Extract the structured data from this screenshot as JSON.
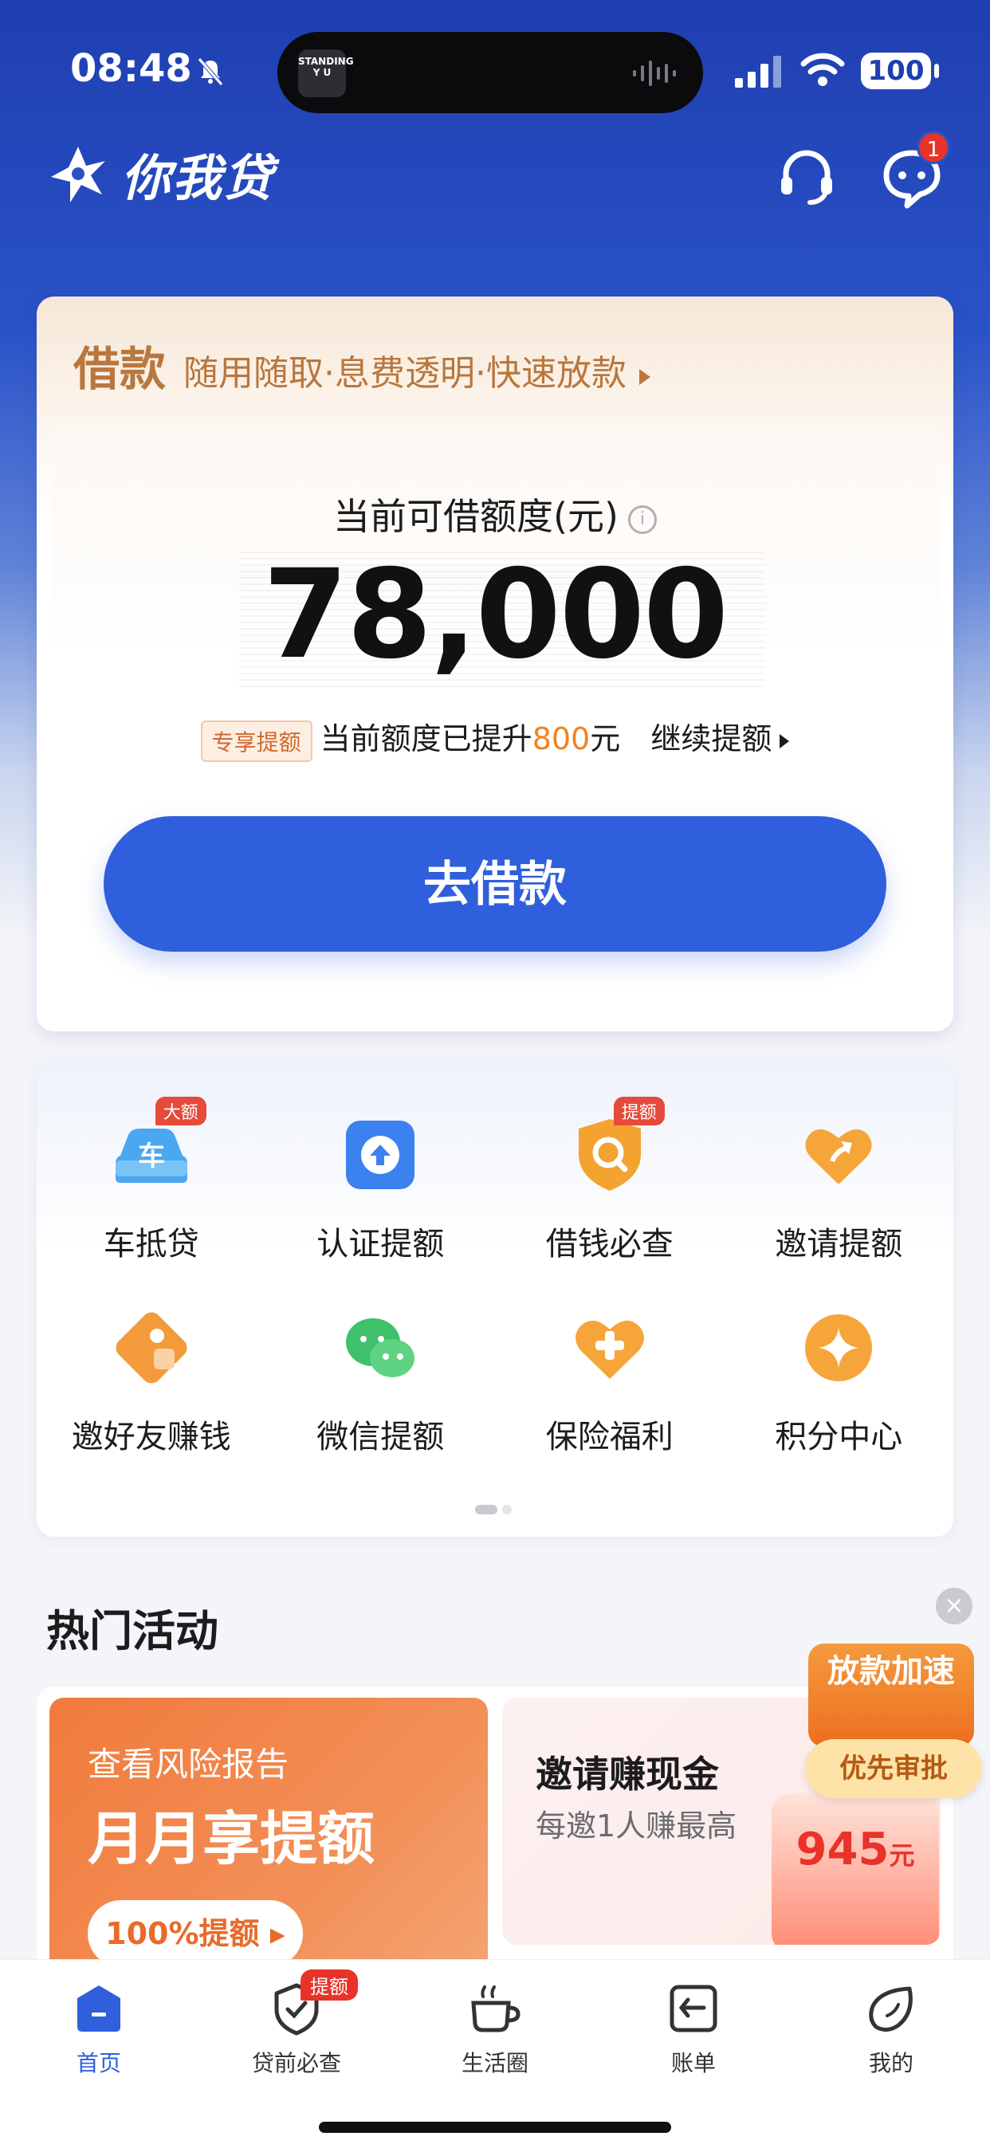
{
  "status": {
    "time": "08:48",
    "battery": "100",
    "island_art": "STANDING Y U"
  },
  "header": {
    "logo_text": "你我贷",
    "message_badge": "1"
  },
  "loan": {
    "head_title": "借款",
    "head_sub": "随用随取·息费透明·快速放款",
    "limit_label": "当前可借额度(元)",
    "amount": "78,000",
    "promo_tag": "专享提额",
    "promo_text": "当前额度已提升",
    "promo_num": "800",
    "promo_unit": "元",
    "promo_link": "继续提额",
    "button": "去借款"
  },
  "grid": {
    "items": [
      {
        "label": "车抵贷",
        "badge": "大额"
      },
      {
        "label": "认证提额",
        "badge": ""
      },
      {
        "label": "借钱必查",
        "badge": "提额"
      },
      {
        "label": "邀请提额",
        "badge": ""
      },
      {
        "label": "邀好友赚钱",
        "badge": ""
      },
      {
        "label": "微信提额",
        "badge": ""
      },
      {
        "label": "保险福利",
        "badge": ""
      },
      {
        "label": "积分中心",
        "badge": ""
      }
    ]
  },
  "hot": {
    "title": "热门活动",
    "act1": {
      "sub": "查看风险报告",
      "title": "月月享提额",
      "button": "100%提额"
    },
    "act2": {
      "title": "邀请赚现金",
      "sub": "每邀1人赚最高",
      "amount": "945",
      "unit": "元"
    }
  },
  "float": {
    "top": "放款加速",
    "bottom": "优先审批"
  },
  "tabbar": {
    "tabs": [
      {
        "label": "首页"
      },
      {
        "label": "贷前必查",
        "badge": "提额"
      },
      {
        "label": "生活圈"
      },
      {
        "label": "账单"
      },
      {
        "label": "我的"
      }
    ]
  },
  "colors": {
    "primary": "#2f5fdc",
    "brand_blue": "#1f3fb0",
    "gold": "#b9773e",
    "orange": "#f2821f",
    "red": "#e8332a"
  }
}
